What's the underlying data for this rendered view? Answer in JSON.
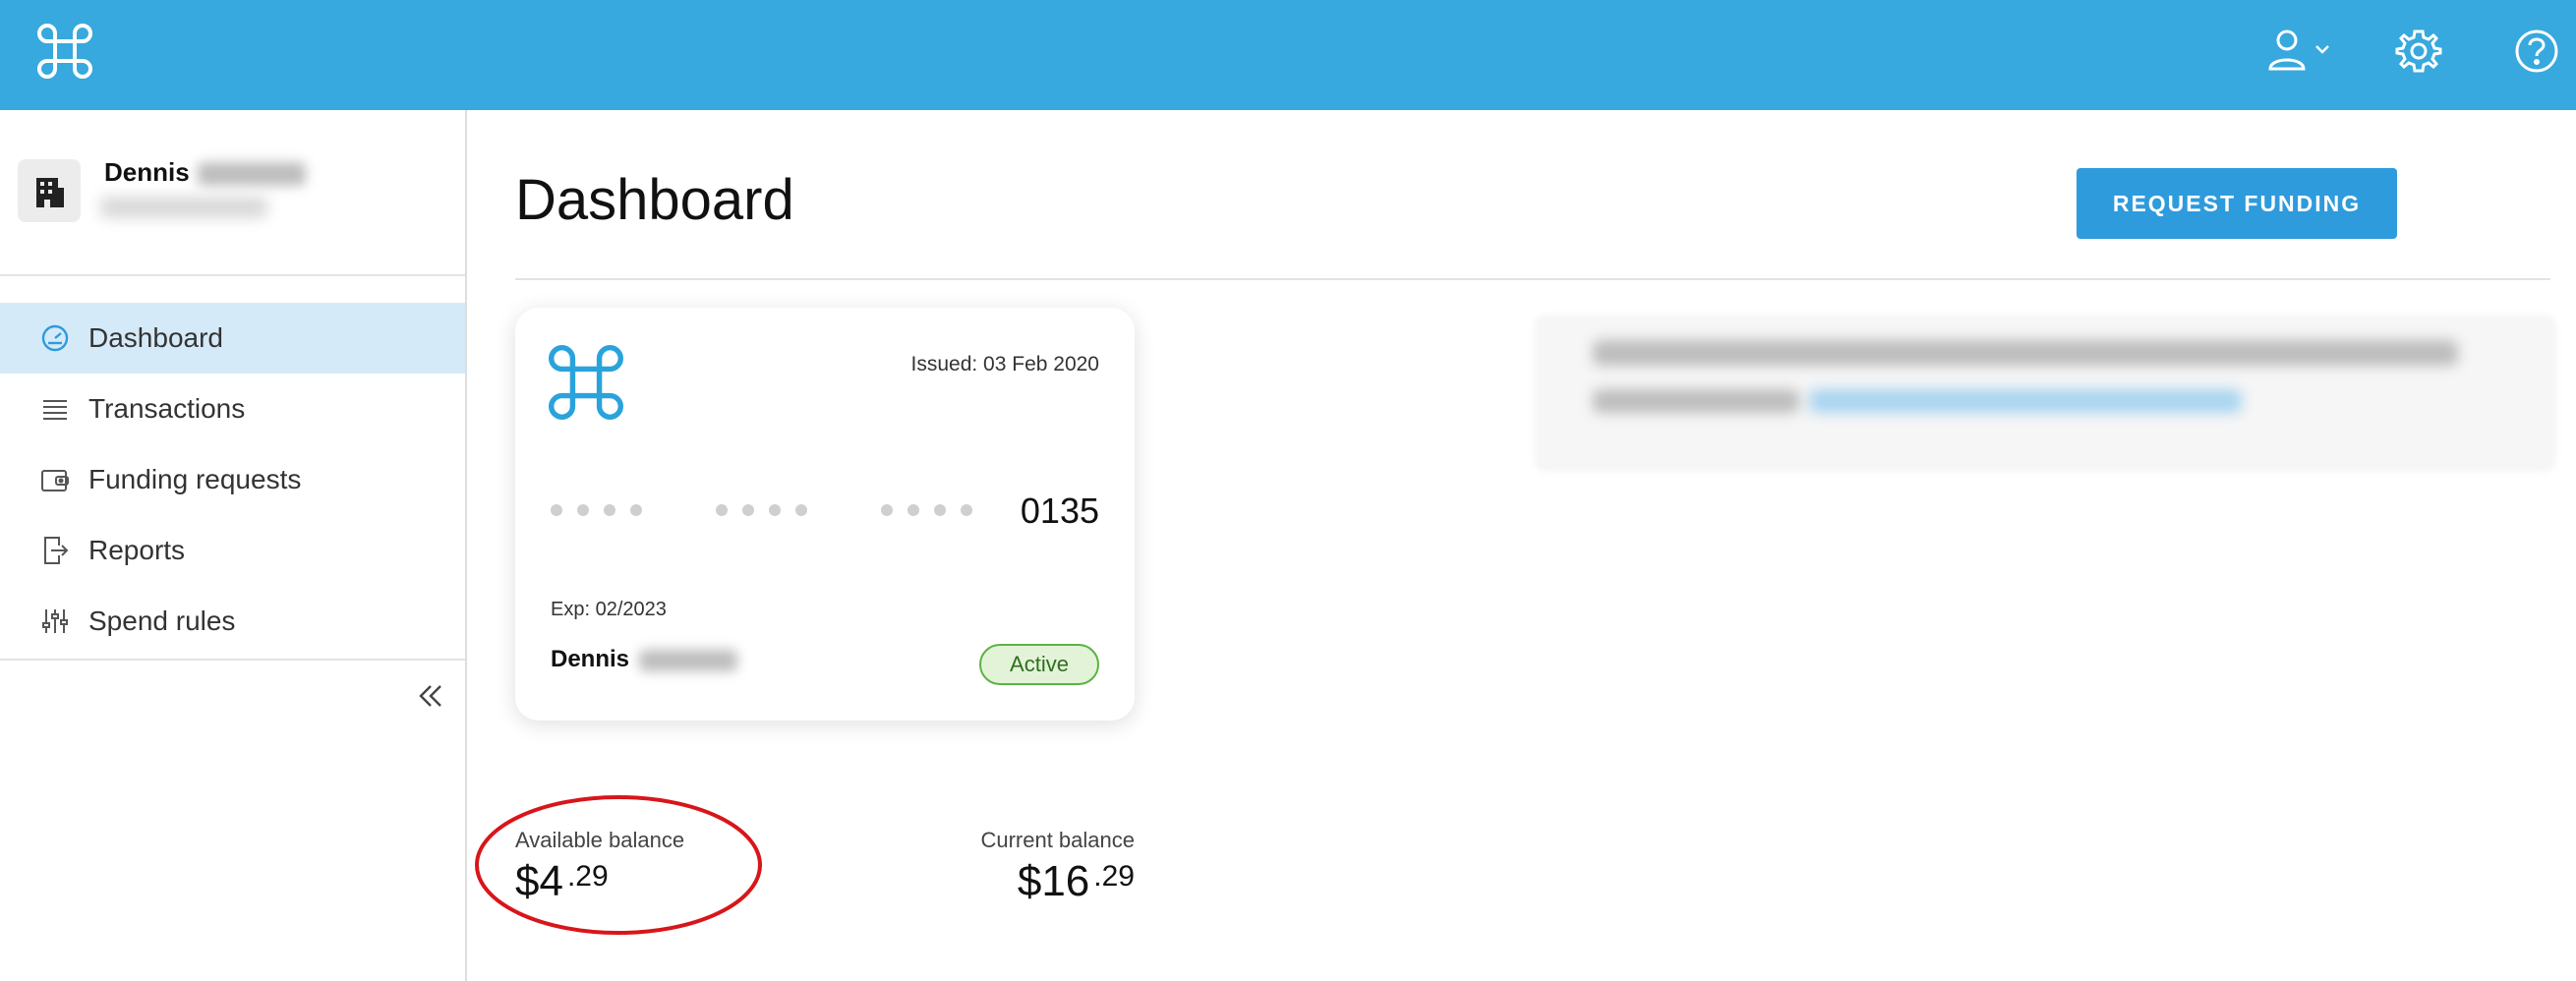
{
  "header": {
    "brand_icon": "command-logo-icon",
    "icons": [
      "user-icon",
      "chevron-down-icon",
      "gear-icon",
      "help-icon"
    ]
  },
  "sidebar": {
    "org_name": "Dennis",
    "items": [
      {
        "label": "Dashboard",
        "icon": "speedometer-icon",
        "active": true
      },
      {
        "label": "Transactions",
        "icon": "list-icon",
        "active": false
      },
      {
        "label": "Funding requests",
        "icon": "wallet-icon",
        "active": false
      },
      {
        "label": "Reports",
        "icon": "report-export-icon",
        "active": false
      },
      {
        "label": "Spend rules",
        "icon": "sliders-icon",
        "active": false
      }
    ]
  },
  "main": {
    "title": "Dashboard",
    "request_button": "REQUEST FUNDING",
    "card": {
      "issued": "Issued: 03 Feb 2020",
      "last4": "0135",
      "expiry": "Exp: 02/2023",
      "holder": "Dennis",
      "status": "Active"
    },
    "balances": {
      "available_label": "Available balance",
      "available_dollars": "$4",
      "available_cents": ".29",
      "current_label": "Current balance",
      "current_dollars": "$16",
      "current_cents": ".29"
    }
  },
  "colors": {
    "header": "#37a9de",
    "button": "#2e9bdc",
    "active_nav": "#d5eaf8",
    "status_border": "#5cb243",
    "highlight": "#d8161a"
  }
}
